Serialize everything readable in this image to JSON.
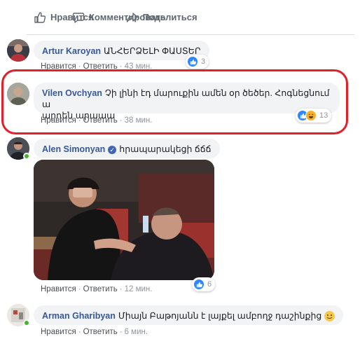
{
  "actions": {
    "like": "Нравится",
    "comment": "Комментировать",
    "share": "Поделиться"
  },
  "comments": [
    {
      "author": "Artur Karoyan",
      "text": "ԱՆՀԵՐՁԵԼԻ ՓԱՍՏԵՐ",
      "like": "Нравится",
      "reply": "Ответить",
      "time": "43 мин.",
      "reactions": "3"
    },
    {
      "author": "Vilen Ovchyan",
      "text_line1": "Չի լինի էդ մարուքին ամեն օր ծեծեր. Հոգնեցնում ա",
      "text_line2": "արդեն արաաա",
      "like": "Нравится",
      "reply": "Ответить",
      "time": "38 мин.",
      "reactions": "13"
    },
    {
      "author": "Alen Simonyan",
      "text": "հրապարակեցի ճճճ",
      "like": "Нравится",
      "reply": "Ответить",
      "time": "12 мин.",
      "reactions": "6"
    },
    {
      "author": "Arman Gharibyan",
      "text": "Միայն Բաթոյանն է լայքել ամբողջ դաշինքից",
      "like": "Нравится",
      "reply": "Ответить",
      "time": "6 мин."
    }
  ],
  "colors": {
    "author": "#385898",
    "bubble": "#f2f3f5",
    "highlight": "#e0202a",
    "like_blue": "#2d88ff",
    "online": "#42b72a"
  }
}
